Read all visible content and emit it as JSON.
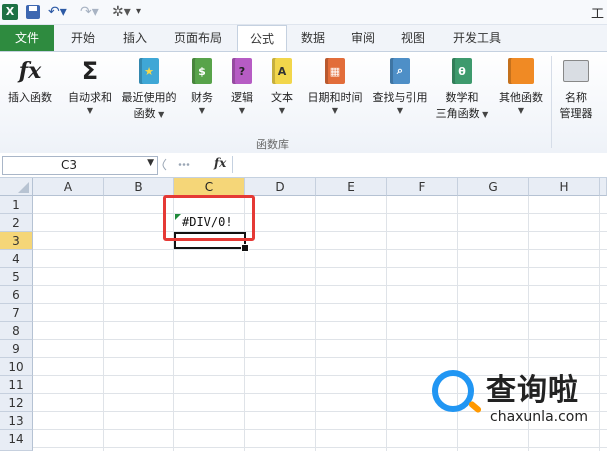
{
  "app": {
    "title_fragment": "工"
  },
  "quick_access": {
    "excel_icon": "X",
    "undo_icon": "undo-arrow",
    "redo_icon": "redo-arrow",
    "tool_icon": "wand-icon"
  },
  "tabs": [
    {
      "label": "文件"
    },
    {
      "label": "开始"
    },
    {
      "label": "插入"
    },
    {
      "label": "页面布局"
    },
    {
      "label": "公式"
    },
    {
      "label": "数据"
    },
    {
      "label": "审阅"
    },
    {
      "label": "视图"
    },
    {
      "label": "开发工具"
    }
  ],
  "active_tab": "公式",
  "ribbon": {
    "insert_function": {
      "line1": "插入函数",
      "icon": "fx"
    },
    "autosum": {
      "line1": "自动求和",
      "icon": "Σ"
    },
    "recent": {
      "line1": "最近使用的",
      "line2": "函数"
    },
    "financial": {
      "line1": "财务"
    },
    "logical": {
      "line1": "逻辑",
      "icon": "?"
    },
    "text": {
      "line1": "文本",
      "icon": "A"
    },
    "datetime": {
      "line1": "日期和时间"
    },
    "lookup": {
      "line1": "查找与引用"
    },
    "math": {
      "line1": "数学和",
      "line2": "三角函数",
      "icon": "θ"
    },
    "more": {
      "line1": "其他函数"
    },
    "name_manager": {
      "line1": "名称",
      "line2": "管理器"
    },
    "group_label": "函数库"
  },
  "formula_bar": {
    "name_box": "C3",
    "fx": "fx",
    "content": ""
  },
  "grid": {
    "columns": [
      "A",
      "B",
      "C",
      "D",
      "E",
      "F",
      "G",
      "H"
    ],
    "rows": [
      "1",
      "2",
      "3",
      "4",
      "5",
      "6",
      "7",
      "8",
      "9",
      "10",
      "11",
      "12",
      "13",
      "14"
    ],
    "selected_col": "C",
    "selected_row": "3",
    "cell_C2": "#DIV/0!"
  },
  "watermark": {
    "cn": "查询啦",
    "url": "chaxunla.com"
  },
  "colors": {
    "file_tab": "#2e8b3f",
    "highlight": "#e53935",
    "header_selected": "#f5d678"
  }
}
